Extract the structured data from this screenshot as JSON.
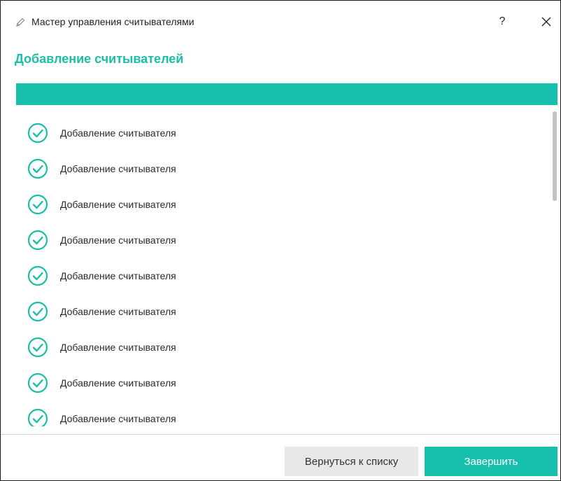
{
  "window": {
    "title": "Мастер управления считывателями",
    "help_label": "?",
    "title_icon": "pencil-icon",
    "close_icon": "close-icon"
  },
  "page": {
    "heading": "Добавление считывателей"
  },
  "progress": {
    "value": 1.0
  },
  "steps": [
    {
      "label": "Добавление считывателя",
      "status": "done"
    },
    {
      "label": "Добавление считывателя",
      "status": "done"
    },
    {
      "label": "Добавление считывателя",
      "status": "done"
    },
    {
      "label": "Добавление считывателя",
      "status": "done"
    },
    {
      "label": "Добавление считывателя",
      "status": "done"
    },
    {
      "label": "Добавление считывателя",
      "status": "done"
    },
    {
      "label": "Добавление считывателя",
      "status": "done"
    },
    {
      "label": "Добавление считывателя",
      "status": "done"
    },
    {
      "label": "Добавление считывателя",
      "status": "done"
    }
  ],
  "footer": {
    "back_label": "Вернуться к списку",
    "finish_label": "Завершить"
  },
  "colors": {
    "accent": "#16c0ad",
    "check_icon": "#1bbfa7",
    "secondary_button": "#e8e8e8"
  }
}
